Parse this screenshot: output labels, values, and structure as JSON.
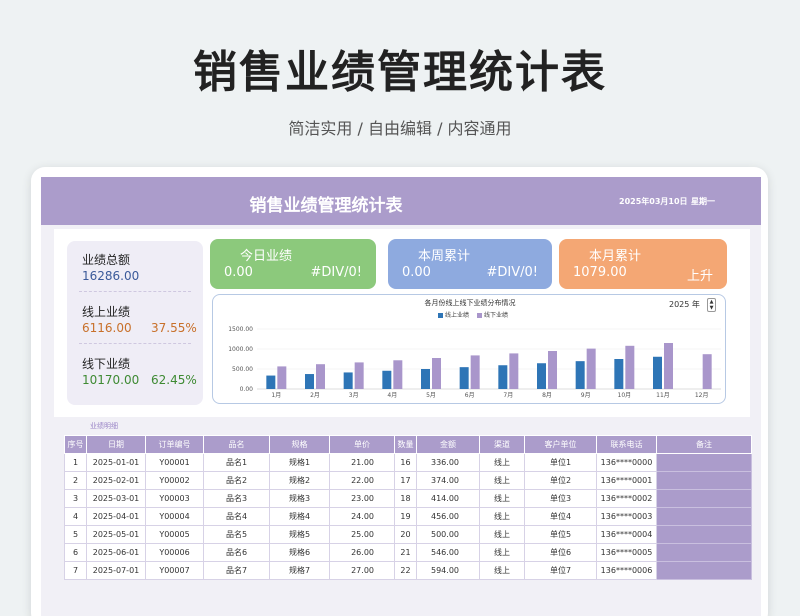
{
  "hero": {
    "title": "销售业绩管理统计表",
    "subtitle": "简洁实用 / 自由编辑 / 内容通用"
  },
  "sheet": {
    "title": "销售业绩管理统计表",
    "date": "2025年03月10日",
    "weekday": "星期一",
    "link": "业绩明细"
  },
  "kpi": {
    "total_label": "业绩总额",
    "total_value": "16286.00",
    "online_label": "线上业绩",
    "online_value": "6116.00",
    "online_pct": "37.55%",
    "offline_label": "线下业绩",
    "offline_value": "10170.00",
    "offline_pct": "62.45%"
  },
  "tiles": [
    {
      "label": "今日业绩",
      "value": "0.00",
      "extra": "#DIV/0!"
    },
    {
      "label": "本周累计",
      "value": "0.00",
      "extra": "#DIV/0!"
    },
    {
      "label": "本月累计",
      "value": "1079.00",
      "extra": "上升"
    }
  ],
  "colors": {
    "banner": "#ab9ccb",
    "tile_green": "#8cc97c",
    "tile_blue": "#8eaadf",
    "tile_orange": "#f4a774",
    "online": "#2e75b6",
    "offline": "#a996cb",
    "value_blue": "#3b5a9a",
    "value_orange": "#c8702a",
    "value_green": "#3e8a33"
  },
  "chart_data": {
    "type": "bar",
    "title": "各月份线上线下业绩分布情况",
    "year": "2025 年",
    "categories": [
      "1月",
      "2月",
      "3月",
      "4月",
      "5月",
      "6月",
      "7月",
      "8月",
      "9月",
      "10月",
      "11月",
      "12月"
    ],
    "series": [
      {
        "name": "线上业绩",
        "values": [
          336,
          374,
          414,
          456,
          500,
          546,
          594,
          644,
          696,
          750,
          806,
          0
        ]
      },
      {
        "name": "线下业绩",
        "values": [
          565,
          620,
          665,
          718,
          775,
          840,
          890,
          950,
          1010,
          1080,
          1150,
          870
        ]
      }
    ],
    "yticks": [
      "1500.00",
      "1000.00",
      "500.00",
      "0.00"
    ],
    "ylim": [
      0,
      1500
    ]
  },
  "table": {
    "headers": [
      "序号",
      "日期",
      "订单编号",
      "品名",
      "规格",
      "单价",
      "数量",
      "金额",
      "渠道",
      "客户单位",
      "联系电话",
      "备注"
    ],
    "rows": [
      [
        "1",
        "2025-01-01",
        "Y00001",
        "品名1",
        "规格1",
        "21.00",
        "16",
        "336.00",
        "线上",
        "单位1",
        "136****0000",
        ""
      ],
      [
        "2",
        "2025-02-01",
        "Y00002",
        "品名2",
        "规格2",
        "22.00",
        "17",
        "374.00",
        "线上",
        "单位2",
        "136****0001",
        ""
      ],
      [
        "3",
        "2025-03-01",
        "Y00003",
        "品名3",
        "规格3",
        "23.00",
        "18",
        "414.00",
        "线上",
        "单位3",
        "136****0002",
        ""
      ],
      [
        "4",
        "2025-04-01",
        "Y00004",
        "品名4",
        "规格4",
        "24.00",
        "19",
        "456.00",
        "线上",
        "单位4",
        "136****0003",
        ""
      ],
      [
        "5",
        "2025-05-01",
        "Y00005",
        "品名5",
        "规格5",
        "25.00",
        "20",
        "500.00",
        "线上",
        "单位5",
        "136****0004",
        ""
      ],
      [
        "6",
        "2025-06-01",
        "Y00006",
        "品名6",
        "规格6",
        "26.00",
        "21",
        "546.00",
        "线上",
        "单位6",
        "136****0005",
        ""
      ],
      [
        "7",
        "2025-07-01",
        "Y00007",
        "品名7",
        "规格7",
        "27.00",
        "22",
        "594.00",
        "线上",
        "单位7",
        "136****0006",
        ""
      ]
    ]
  }
}
